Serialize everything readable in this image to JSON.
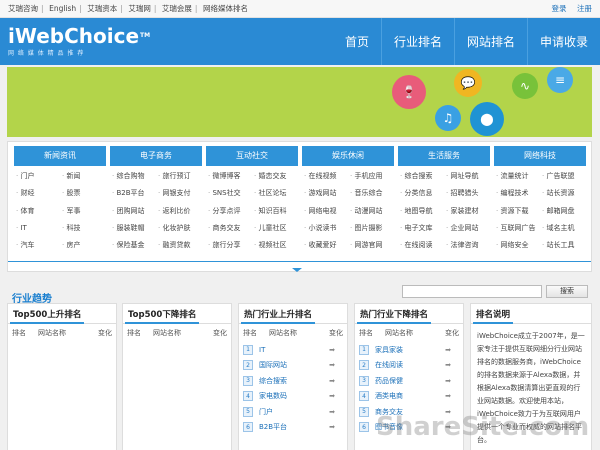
{
  "topbar": {
    "links": [
      "艾瑞咨询",
      "English",
      "艾瑞资本",
      "艾瑞网",
      "艾瑞会展",
      "网络媒体排名"
    ],
    "login": "登录",
    "register": "注册"
  },
  "header": {
    "logo_main": "iWebChoice",
    "logo_tm": "TM",
    "logo_sub": "网 络 媒 体 精 品 推 荐",
    "nav": [
      "首页",
      "行业排名",
      "网站排名",
      "申请收录"
    ]
  },
  "banner": {
    "bubbles": [
      {
        "icon": "wine-glass-icon",
        "glyph": "🍷",
        "color": "#e85c7a"
      },
      {
        "icon": "chat-bubble-icon",
        "glyph": "💬",
        "color": "#f0b622"
      },
      {
        "icon": "music-note-icon",
        "glyph": "♫",
        "color": "#3aa0e3"
      },
      {
        "icon": "location-pin-icon",
        "glyph": "⬤",
        "color": "#1f93d4"
      },
      {
        "icon": "pulse-icon",
        "glyph": "∿",
        "color": "#78c23a"
      },
      {
        "icon": "lines-icon",
        "glyph": "≡",
        "color": "#4aa9e6"
      }
    ]
  },
  "categories": [
    {
      "title": "新闻资讯",
      "items": [
        "门户",
        "新闻",
        "财经",
        "股票",
        "体育",
        "军事",
        "IT",
        "科技",
        "汽车",
        "房产"
      ]
    },
    {
      "title": "电子商务",
      "items": [
        "综合购物",
        "旅行预订",
        "B2B平台",
        "网银支付",
        "团购网站",
        "返利比价",
        "服装鞋帽",
        "化妆护肤",
        "保险基金",
        "融资贷款"
      ]
    },
    {
      "title": "互动社交",
      "items": [
        "微博博客",
        "婚恋交友",
        "SNS社交",
        "社区论坛",
        "分享点评",
        "知识百科",
        "商务交友",
        "儿童社区",
        "旅行分享",
        "视频社区"
      ]
    },
    {
      "title": "娱乐休闲",
      "items": [
        "在线视频",
        "手机应用",
        "游戏网站",
        "音乐综合",
        "网络电视",
        "动漫网站",
        "小说读书",
        "图片摄影",
        "收藏爱好",
        "网游官网"
      ]
    },
    {
      "title": "生活服务",
      "items": [
        "综合搜索",
        "网址导航",
        "分类信息",
        "招聘猎头",
        "地图导航",
        "家装建材",
        "电子文库",
        "企业网站",
        "在线阅读",
        "法律咨询"
      ]
    },
    {
      "title": "网络科技",
      "items": [
        "流量统计",
        "广告联盟",
        "编程技术",
        "站长资源",
        "资源下载",
        "邮箱网盘",
        "互联网广告",
        "域名主机",
        "网络安全",
        "站长工具"
      ]
    }
  ],
  "trend": {
    "title": "行业趋势",
    "search_placeholder": "",
    "search_button": "搜索"
  },
  "panels": {
    "top500_up": {
      "title": "Top500上升排名",
      "cols": [
        "排名",
        "网站名称",
        "变化"
      ]
    },
    "top500_down": {
      "title": "Top500下降排名",
      "cols": [
        "排名",
        "网站名称",
        "变化"
      ]
    },
    "hot_up": {
      "title": "热门行业上升排名",
      "cols": [
        "排名",
        "网站名称",
        "变化"
      ],
      "rows": [
        {
          "rank": "1",
          "name": "IT"
        },
        {
          "rank": "2",
          "name": "国际网站"
        },
        {
          "rank": "3",
          "name": "综合搜索"
        },
        {
          "rank": "4",
          "name": "家电数码"
        },
        {
          "rank": "5",
          "name": "门户"
        },
        {
          "rank": "6",
          "name": "B2B平台"
        }
      ]
    },
    "hot_down": {
      "title": "热门行业下降排名",
      "cols": [
        "排名",
        "网站名称",
        "变化"
      ],
      "rows": [
        {
          "rank": "1",
          "name": "家具家装"
        },
        {
          "rank": "2",
          "name": "在线阅读"
        },
        {
          "rank": "3",
          "name": "药品保健"
        },
        {
          "rank": "4",
          "name": "酒类电商"
        },
        {
          "rank": "5",
          "name": "商务交友"
        },
        {
          "rank": "6",
          "name": "图书音像"
        }
      ]
    },
    "about": {
      "title": "排名说明",
      "text": "iWebChoice成立于2007年，是一家专注于提供互联网细分行业网站排名的数据服务商，iWebChoice的排名数据来源于Alexa数据，并根据Alexa数据清算出更直观的行业网站数据。欢迎使用本站，iWebChoice致力于为互联网用户提供一个专业而权威的网站排名平台。"
    }
  },
  "watermark": "ShareSite.com"
}
